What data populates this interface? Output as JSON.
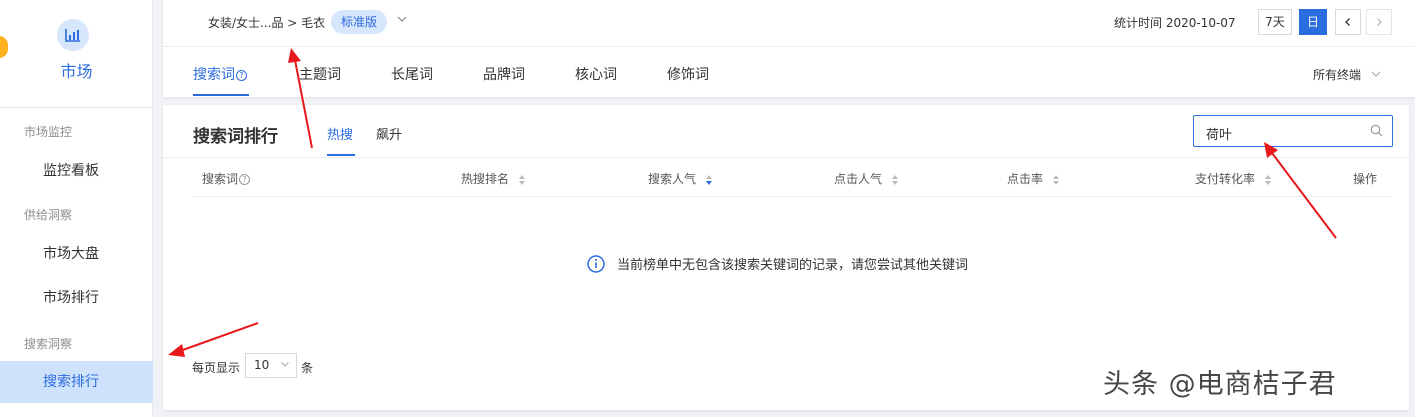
{
  "sidebar": {
    "title": "市场",
    "groups": [
      {
        "label": "市场监控",
        "items": [
          "监控看板"
        ]
      },
      {
        "label": "供给洞察",
        "items": [
          "市场大盘",
          "市场排行"
        ]
      },
      {
        "label": "搜索洞察",
        "items": [
          "搜索排行"
        ]
      }
    ],
    "active_item": "搜索排行"
  },
  "header": {
    "breadcrumb": "女装/女士...品 > 毛衣",
    "version_badge": "标准版",
    "stat_time_label": "统计时间 2020-10-07",
    "range_buttons": [
      "7天",
      "日"
    ],
    "active_range": "日",
    "prev_icon": "chevron-left-icon",
    "next_icon": "chevron-right-icon"
  },
  "tabs": [
    {
      "label": "搜索词",
      "has_help": true
    },
    {
      "label": "主题词"
    },
    {
      "label": "长尾词"
    },
    {
      "label": "品牌词"
    },
    {
      "label": "核心词"
    },
    {
      "label": "修饰词"
    }
  ],
  "active_tab": "搜索词",
  "terminal_select": "所有终端",
  "ranking": {
    "title": "搜索词排行",
    "sub_tabs": [
      "热搜",
      "飙升"
    ],
    "active_sub_tab": "热搜",
    "search_value": "荷叶",
    "columns": [
      {
        "label": "搜索词",
        "help": true
      },
      {
        "label": "热搜排名",
        "sortable": true
      },
      {
        "label": "搜索人气",
        "sortable": true,
        "sorted": "desc"
      },
      {
        "label": "点击人气",
        "sortable": true
      },
      {
        "label": "点击率",
        "sortable": true
      },
      {
        "label": "支付转化率",
        "sortable": true
      },
      {
        "label": "操作"
      }
    ],
    "empty_message": "当前榜单中无包含该搜索关键词的记录，请您尝试其他关键词",
    "page_size_label": "每页显示",
    "page_size_value": "10",
    "page_size_unit": "条"
  },
  "watermark": "头条 @电商桔子君",
  "colors": {
    "accent": "#2b6cde",
    "accent_light": "#d6e6fb",
    "annotation_arrow": "#e8191c"
  }
}
